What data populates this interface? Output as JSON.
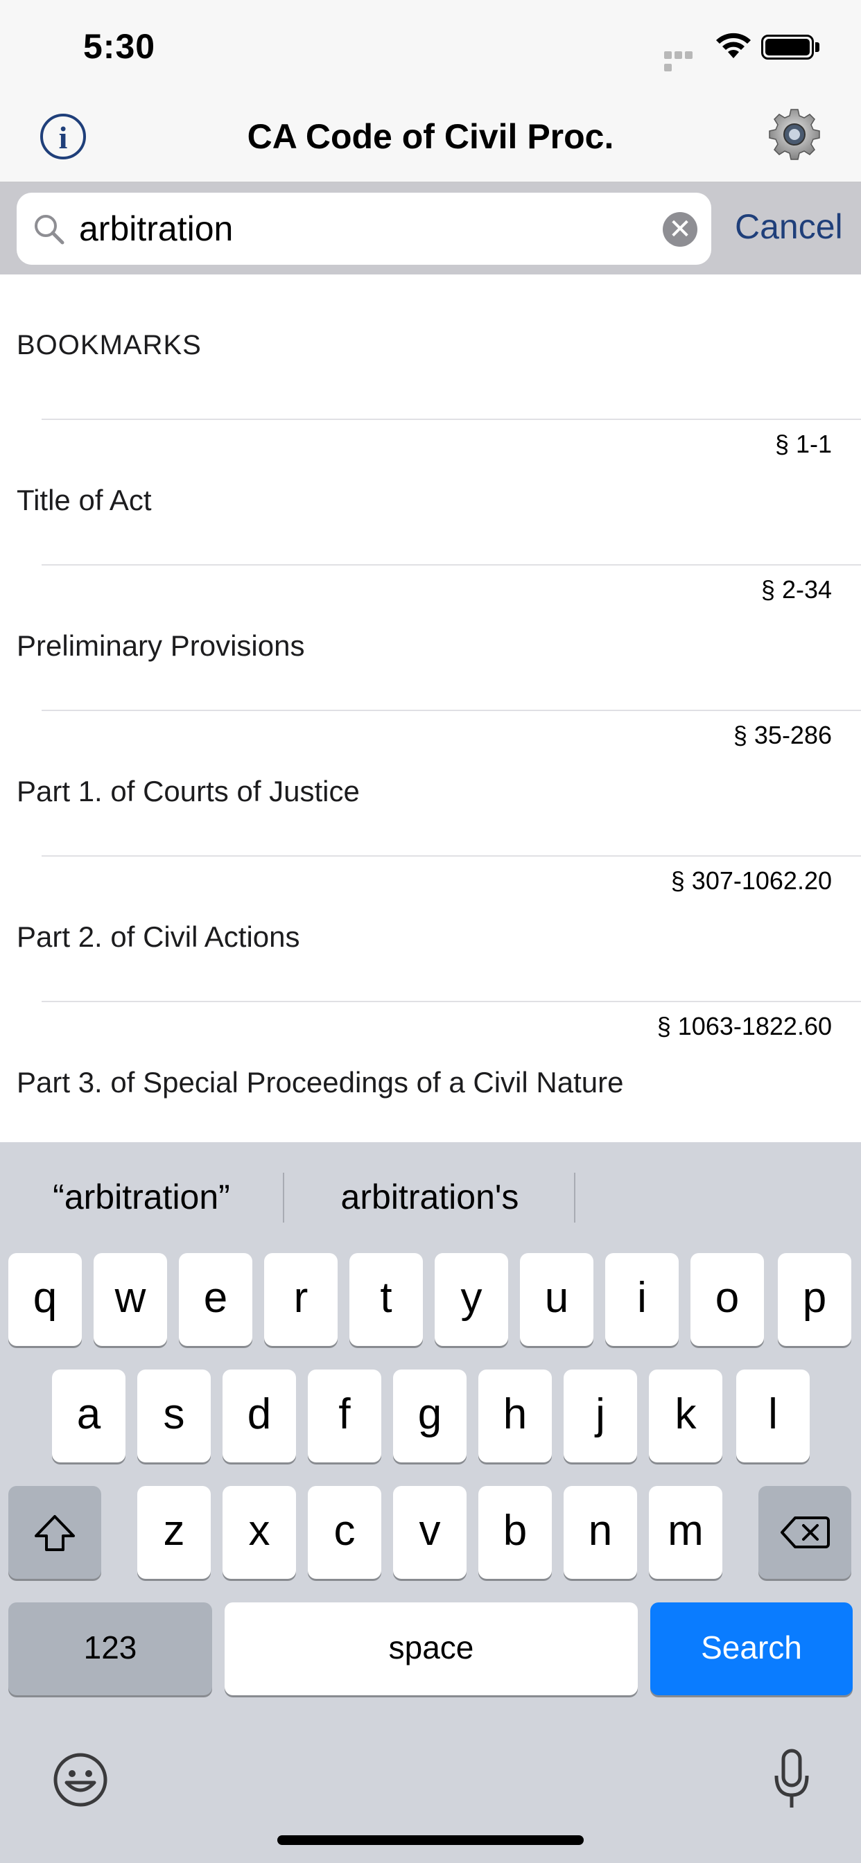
{
  "status_bar": {
    "time": "5:30"
  },
  "nav": {
    "title": "CA Code of Civil Proc.",
    "info_glyph": "i"
  },
  "search": {
    "value": "arbitration",
    "cancel_label": "Cancel",
    "clear_glyph": "✕"
  },
  "list": {
    "section_header": "BOOKMARKS",
    "rows": [
      {
        "range": "§ 1-1",
        "title": "Title of Act"
      },
      {
        "range": "§ 2-34",
        "title": "Preliminary Provisions"
      },
      {
        "range": "§ 35-286",
        "title": "Part 1.  of Courts of Justice"
      },
      {
        "range": "§ 307-1062.20",
        "title": "Part 2.  of Civil Actions"
      },
      {
        "range": "§ 1063-1822.60",
        "title": "Part 3.  of Special Proceedings of a Civil Nature"
      }
    ]
  },
  "keyboard": {
    "suggestions": [
      "“arbitration”",
      "arbitration's"
    ],
    "row1": [
      "q",
      "w",
      "e",
      "r",
      "t",
      "y",
      "u",
      "i",
      "o",
      "p"
    ],
    "row2": [
      "a",
      "s",
      "d",
      "f",
      "g",
      "h",
      "j",
      "k",
      "l"
    ],
    "row3": [
      "z",
      "x",
      "c",
      "v",
      "b",
      "n",
      "m"
    ],
    "numbers_label": "123",
    "space_label": "space",
    "search_label": "Search"
  },
  "colors": {
    "accent": "#1f3f7a",
    "search_key": "#0a7cff",
    "keyboard_bg": "#d1d4db"
  },
  "icons": [
    "info-icon",
    "gear-icon",
    "search-icon",
    "clear-icon",
    "shift-icon",
    "backspace-icon",
    "emoji-icon",
    "microphone-icon",
    "wifi-icon",
    "battery-icon"
  ]
}
